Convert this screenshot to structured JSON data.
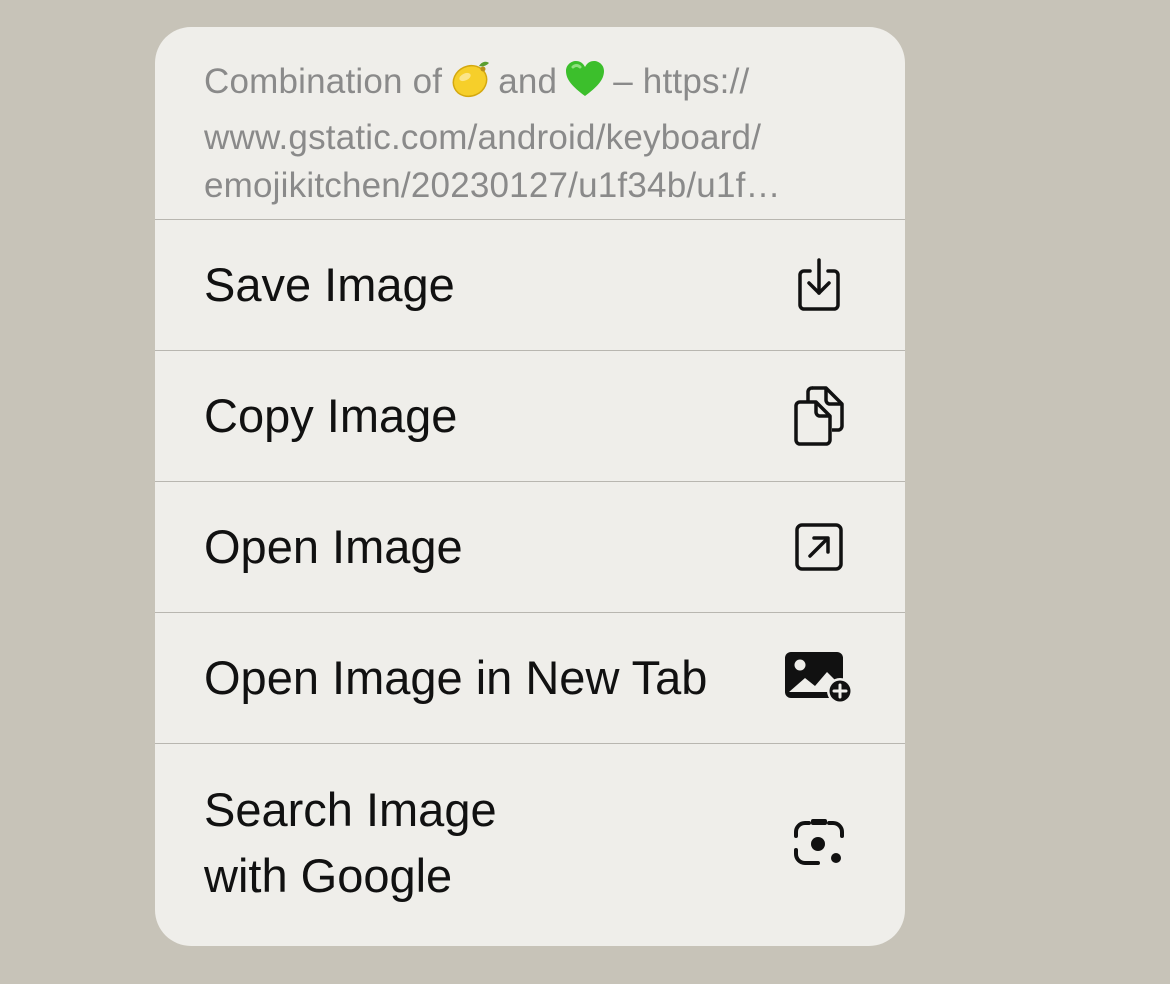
{
  "header": {
    "prefix": "Combination of",
    "emoji_1": "lemon-emoji",
    "connector": "and",
    "emoji_2": "green-heart-emoji",
    "url_start": "– https://",
    "line_2": "www.gstatic.com/android/keyboard/",
    "line_3": "emojikitchen/20230127/u1f34b/u1f…"
  },
  "menu": {
    "save_label": "Save Image",
    "save_icon": "download-icon",
    "copy_label": "Copy Image",
    "copy_icon": "copy-documents-icon",
    "open_label": "Open Image",
    "open_icon": "open-arrow-square-icon",
    "open_new_tab_label": "Open Image in New Tab",
    "open_new_tab_icon": "image-plus-icon",
    "search_label_line1": "Search Image",
    "search_label_line2": "with Google",
    "search_icon": "google-lens-icon"
  },
  "colors": {
    "background": "#c7c3b8",
    "menu_bg": "#efeeea",
    "header_text": "#8a8a8a",
    "item_text": "#111111",
    "separator": "#b8b6b0"
  }
}
